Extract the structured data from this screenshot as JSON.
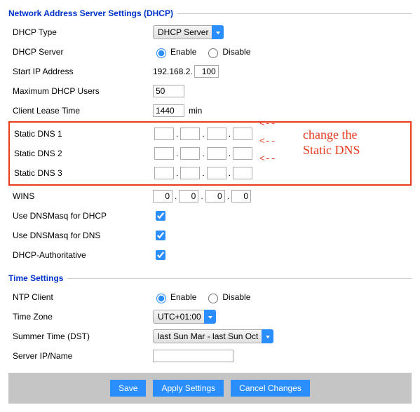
{
  "dhcp_section_title": "Network Address Server Settings (DHCP)",
  "time_section_title": "Time Settings",
  "labels": {
    "dhcp_type": "DHCP Type",
    "dhcp_server": "DHCP Server",
    "start_ip": "Start IP Address",
    "max_users": "Maximum DHCP Users",
    "lease": "Client Lease Time",
    "dns1": "Static DNS 1",
    "dns2": "Static DNS 2",
    "dns3": "Static DNS 3",
    "wins": "WINS",
    "dnsmasq_dhcp": "Use DNSMasq for DHCP",
    "dnsmasq_dns": "Use DNSMasq for DNS",
    "dhcp_auth": "DHCP-Authoritative",
    "ntp": "NTP Client",
    "tz": "Time Zone",
    "dst": "Summer Time (DST)",
    "server_ip": "Server IP/Name",
    "enable": "Enable",
    "disable": "Disable",
    "minutes": "min"
  },
  "values": {
    "dhcp_type": "DHCP Server",
    "start_ip_prefix": "192.168.2.",
    "start_ip_last": "100",
    "max_users": "50",
    "lease": "1440",
    "wins": [
      "0",
      "0",
      "0",
      "0"
    ],
    "tz": "UTC+01:00",
    "dst": "last Sun Mar - last Sun Oct",
    "dns1": [
      "",
      "",
      "",
      ""
    ],
    "dns2": [
      "",
      "",
      "",
      ""
    ],
    "dns3": [
      "",
      "",
      "",
      ""
    ],
    "server_ip": ""
  },
  "state": {
    "dhcp_server_enabled": true,
    "dnsmasq_dhcp": true,
    "dnsmasq_dns": true,
    "dhcp_auth": true,
    "ntp_enabled": true
  },
  "buttons": {
    "save": "Save",
    "apply": "Apply Settings",
    "cancel": "Cancel Changes"
  },
  "annotation": "change the\nStatic DNS",
  "arrows": "<--"
}
